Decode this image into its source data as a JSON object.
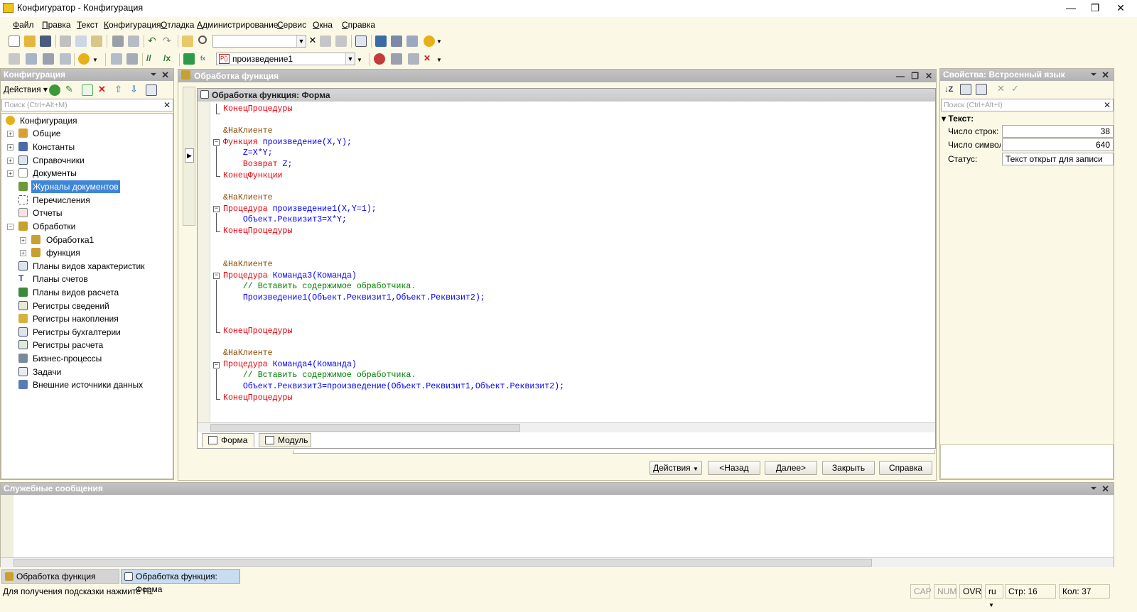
{
  "window": {
    "title": "Конфигуратор - Конфигурация",
    "minimize": "—",
    "restore": "❐",
    "close": "✕"
  },
  "menu": [
    "Файл",
    "Правка",
    "Текст",
    "Конфигурация",
    "Отладка",
    "Администрирование",
    "Сервис",
    "Окна",
    "Справка"
  ],
  "toolbar": {
    "procedure_combo": "произведение1",
    "procedure_badge": "Р()"
  },
  "config_panel": {
    "title": "Конфигурация",
    "actions_label": "Действия",
    "search_placeholder": "Поиск (Ctrl+Alt+M)",
    "items": [
      {
        "label": "Конфигурация"
      },
      {
        "label": "Общие"
      },
      {
        "label": "Константы"
      },
      {
        "label": "Справочники"
      },
      {
        "label": "Документы"
      },
      {
        "label": "Журналы документов"
      },
      {
        "label": "Перечисления"
      },
      {
        "label": "Отчеты"
      },
      {
        "label": "Обработки"
      },
      {
        "label": "Обработка1"
      },
      {
        "label": "функция"
      },
      {
        "label": "Планы видов характеристик"
      },
      {
        "label": "Планы счетов"
      },
      {
        "label": "Планы видов расчета"
      },
      {
        "label": "Регистры сведений"
      },
      {
        "label": "Регистры накопления"
      },
      {
        "label": "Регистры бухгалтерии"
      },
      {
        "label": "Регистры расчета"
      },
      {
        "label": "Бизнес-процессы"
      },
      {
        "label": "Задачи"
      },
      {
        "label": "Внешние источники данных"
      }
    ]
  },
  "editor": {
    "window_title": "Обработка функция",
    "form_title": "Обработка функция: Форма",
    "tabs": [
      "Форма",
      "Модуль"
    ],
    "code": [
      "КонецПроцедуры",
      "",
      "&НаКлиенте",
      "Функция произведение(X,Y);",
      "    Z=X*Y;",
      "    Возврат Z;",
      "КонецФункции",
      "",
      "&НаКлиенте",
      "Процедура произведение1(X,Y=1);",
      "    Объект.Реквизит3=X*Y;",
      "КонецПроцедуры",
      "",
      "",
      "&НаКлиенте",
      "Процедура Команда3(Команда)",
      "    // Вставить содержимое обработчика.",
      "    Произведение1(Объект.Реквизит1,Объект.Реквизит2);",
      "",
      "",
      "КонецПроцедуры",
      "",
      "&НаКлиенте",
      "Процедура Команда4(Команда)",
      "    // Вставить содержимое обработчика.",
      "    Объект.Реквизит3=произведение(Объект.Реквизит1,Объект.Реквизит2);",
      "КонецПроцедуры"
    ],
    "buttons": {
      "actions": "Действия",
      "back": "<Назад",
      "next": "Далее>",
      "close": "Закрыть",
      "help": "Справка"
    }
  },
  "properties": {
    "title": "Свойства: Встроенный язык",
    "search_placeholder": "Поиск (Ctrl+Alt+I)",
    "group": "Текст:",
    "rows": [
      {
        "label": "Число строк:",
        "value": "38"
      },
      {
        "label": "Число символов:",
        "value": "640"
      },
      {
        "label": "Статус:",
        "value": "Текст открыт для записи"
      }
    ]
  },
  "messages": {
    "title": "Служебные сообщения"
  },
  "taskbar": [
    "Обработка функция",
    "Обработка функция: Форма"
  ],
  "statusbar": {
    "hint": "Для получения подсказки нажмите F1",
    "cap": "CAP",
    "num": "NUM",
    "ovr": "OVR",
    "lang": "ru",
    "line": "Стр: 16",
    "col": "Кол: 37"
  }
}
